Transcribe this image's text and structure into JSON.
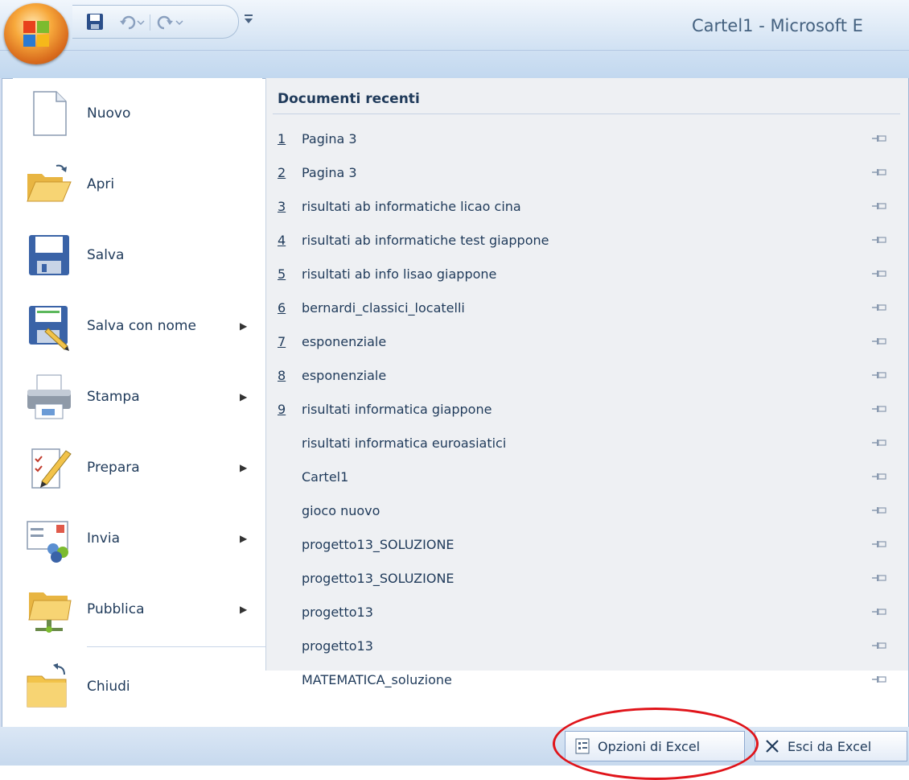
{
  "window": {
    "title": "Cartel1 - Microsoft E"
  },
  "quick_access": [
    {
      "icon": "save-icon"
    },
    {
      "icon": "undo-icon"
    },
    {
      "icon": "redo-icon"
    },
    {
      "icon": "customize-qat-icon"
    }
  ],
  "left_menu": [
    {
      "id": "nuovo",
      "label": "Nuovo",
      "icon": "new-document-icon",
      "submenu": false
    },
    {
      "id": "apri",
      "label": "Apri",
      "icon": "open-folder-icon",
      "submenu": false
    },
    {
      "id": "salva",
      "label": "Salva",
      "icon": "save-icon",
      "submenu": false
    },
    {
      "id": "salva-con-nome",
      "label": "Salva con nome",
      "icon": "save-as-icon",
      "submenu": true
    },
    {
      "id": "stampa",
      "label": "Stampa",
      "icon": "printer-icon",
      "submenu": true
    },
    {
      "id": "prepara",
      "label": "Prepara",
      "icon": "prepare-icon",
      "submenu": true
    },
    {
      "id": "invia",
      "label": "Invia",
      "icon": "send-icon",
      "submenu": true
    },
    {
      "id": "pubblica",
      "label": "Pubblica",
      "icon": "publish-icon",
      "submenu": true
    },
    {
      "id": "chiudi",
      "label": "Chiudi",
      "icon": "close-folder-icon",
      "submenu": false
    }
  ],
  "recent_documents": {
    "title": "Documenti recenti",
    "items": [
      {
        "num": "1",
        "name": "Pagina 3"
      },
      {
        "num": "2",
        "name": "Pagina 3"
      },
      {
        "num": "3",
        "name": "risultati ab informatiche licao cina"
      },
      {
        "num": "4",
        "name": "risultati ab informatiche test giappone"
      },
      {
        "num": "5",
        "name": "risultati ab info lisao giappone"
      },
      {
        "num": "6",
        "name": "bernardi_classici_locatelli"
      },
      {
        "num": "7",
        "name": "esponenziale"
      },
      {
        "num": "8",
        "name": "esponenziale"
      },
      {
        "num": "9",
        "name": "risultati informatica giappone"
      },
      {
        "num": "",
        "name": "risultati informatica euroasiatici"
      },
      {
        "num": "",
        "name": "Cartel1"
      },
      {
        "num": "",
        "name": "gioco nuovo"
      },
      {
        "num": "",
        "name": "progetto13_SOLUZIONE"
      },
      {
        "num": "",
        "name": "progetto13_SOLUZIONE"
      },
      {
        "num": "",
        "name": "progetto13"
      },
      {
        "num": "",
        "name": "progetto13"
      },
      {
        "num": "",
        "name": "MATEMATICA_soluzione"
      }
    ]
  },
  "bottom": {
    "options_label": "Opzioni di Excel",
    "exit_label": "Esci da Excel"
  },
  "colors": {
    "highlight": "#e0141a",
    "text": "#1f3a5a",
    "panel": "#eef0f3"
  }
}
